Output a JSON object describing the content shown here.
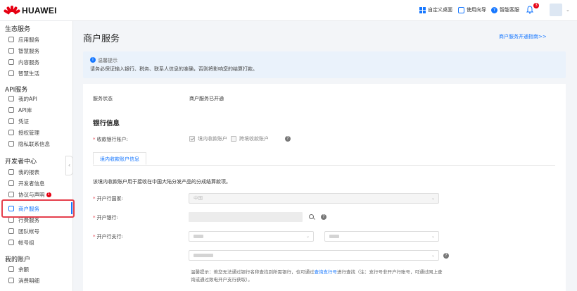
{
  "brand": {
    "name": "HUAWEI",
    "color": "#e60012"
  },
  "topbar": {
    "desktop_label": "自定义桌面",
    "guide_label": "使用向导",
    "service_label": "智能客服",
    "notification_count": "3",
    "icons": [
      "grid-icon",
      "guide-icon",
      "help-icon",
      "bell-icon",
      "chevron-down-icon"
    ]
  },
  "sidebar": {
    "groups": [
      {
        "title": "生态服务",
        "items": [
          "应用服务",
          "智慧服务",
          "内容服务",
          "智慧生活"
        ]
      },
      {
        "title": "API服务",
        "items": [
          "我的API",
          "API库",
          "凭证",
          "授权管理",
          "隐私联系信息"
        ]
      },
      {
        "title": "开发者中心",
        "items": [
          "我的报表",
          "开发者信息",
          "协议与声明",
          "商户服务",
          "行费服务",
          "团队帐号",
          "帐号组"
        ]
      },
      {
        "title": "我的账户",
        "items": [
          "余额",
          "消费明细"
        ]
      }
    ],
    "active_item": "商户服务",
    "agreement_badge": "1"
  },
  "page": {
    "title": "商户服务",
    "guide_link": "商户服务开通指南>>"
  },
  "notice": {
    "title": "温馨提示",
    "body": "请务必保证输入银行、税务、联系人信息的准确，否则将影响您的结算打款。"
  },
  "form": {
    "status_label": "服务状态",
    "status_value": "商户服务已开通",
    "section_title": "银行信息",
    "account_label": "收款银行账户:",
    "domestic_option": "境内收款账户",
    "cross_border_option": "跨境收款账户",
    "domestic_checked": true,
    "cross_border_checked": false,
    "tab_label": "境内收款账户信息",
    "description": "该境内收款账户用于接收在中国大陆分发产品的分成结算款项。",
    "country_label": "开户行国家:",
    "country_value": "中国",
    "bank_label": "开户银行:",
    "branch_label": "开户行支行:",
    "hint_prefix": "温馨提示：若您无法通过银行名称查找到所需银行，也可通过",
    "hint_link": "查询支行号",
    "hint_suffix": "进行查找（注：支行号非开户行账号，可通过网上查询或通过致电开户支行获取）。"
  }
}
